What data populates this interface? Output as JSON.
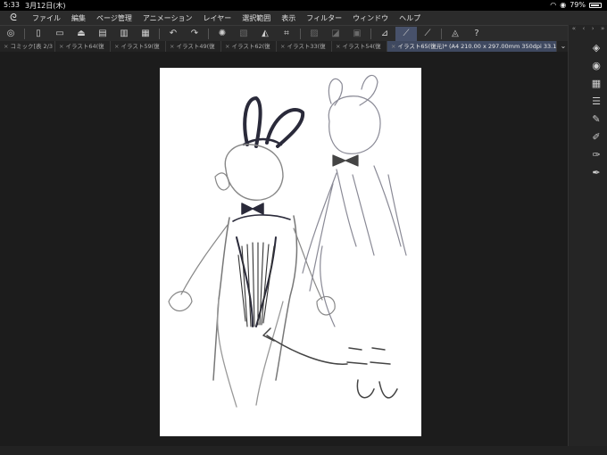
{
  "status": {
    "time": "5:33",
    "date": "3月12日(木)",
    "battery": "79%"
  },
  "menu": [
    "ファイル",
    "編集",
    "ページ管理",
    "アニメーション",
    "レイヤー",
    "選択範囲",
    "表示",
    "フィルター",
    "ウィンドウ",
    "ヘルプ"
  ],
  "tabs": [
    {
      "label": "コミック[表 2/3"
    },
    {
      "label": "イラスト64(復"
    },
    {
      "label": "イラスト59(復"
    },
    {
      "label": "イラスト49(復"
    },
    {
      "label": "イラスト62(復"
    },
    {
      "label": "イラスト33(復"
    },
    {
      "label": "イラスト54(復"
    },
    {
      "label": "イラスト65(復元)* (A4 210.00 x 297.00mm 350dpi 33.1%)"
    }
  ],
  "icons": {
    "logo": "clip-studio-logo-icon",
    "toolbar": [
      "canvas-view-icon",
      "new-file-icon",
      "open-file-icon",
      "save-icon",
      "page-icon",
      "page-export-icon",
      "page-settings-icon",
      "undo-icon",
      "redo-icon",
      "loading-icon",
      "clear-icon",
      "fill-icon",
      "crop-icon",
      "transparent-icon",
      "transparent-alt-icon",
      "transparent-alt2-icon",
      "pen-check-icon",
      "pen-active-icon",
      "pen-alt-icon",
      "sharing-icon",
      "help-icon"
    ],
    "right": [
      "layers-icon",
      "navigator-icon",
      "material-icon",
      "sub-tool-icon",
      "brush-icon",
      "tool-property-icon",
      "color-icon",
      "brush-size-icon"
    ]
  },
  "colors": {
    "accent": "#47516a",
    "active_tab": "#3f4960"
  }
}
